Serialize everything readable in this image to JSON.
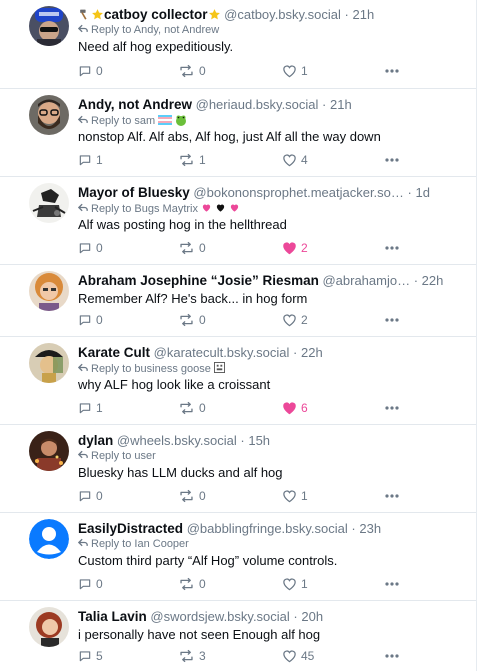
{
  "posts": [
    {
      "name": "catboy collector",
      "name_prefix_icons": [
        "hammer-icon",
        "star-icon"
      ],
      "name_suffix_icon": "star-icon",
      "handle": "@catboy.bsky.social",
      "time": "21h",
      "reply_to": "Reply to Andy, not Andrew",
      "text": "Need alf hog expeditiously.",
      "replies": "0",
      "reposts": "0",
      "likes": "1",
      "liked": false
    },
    {
      "name": "Andy, not Andrew",
      "handle": "@heriaud.bsky.social",
      "time": "21h",
      "reply_to": "Reply to sam",
      "reply_icons": [
        "flag-icon",
        "frog-icon"
      ],
      "text": "nonstop Alf. Alf abs, Alf hog, just Alf all the way down",
      "replies": "1",
      "reposts": "1",
      "likes": "4",
      "liked": false
    },
    {
      "name": "Mayor of Bluesky",
      "handle": "@bokononsprophet.meatjacker.so…",
      "time": "1d",
      "reply_to": "Reply to Bugs Maytrix",
      "reply_icons": [
        "pink-heart-icon",
        "black-heart-icon",
        "pink-heart-icon"
      ],
      "text": "Alf was posting hog in the hellthread",
      "replies": "0",
      "reposts": "0",
      "likes": "2",
      "liked": true
    },
    {
      "name": "Abraham Josephine “Josie” Riesman",
      "handle": "@abrahamjo…",
      "time": "22h",
      "reply_to": "",
      "text": "Remember Alf? He's back... in hog form",
      "replies": "0",
      "reposts": "0",
      "likes": "2",
      "liked": false
    },
    {
      "name": "Karate Cult",
      "handle": "@karatecult.bsky.social",
      "time": "22h",
      "reply_to": "Reply to business goose",
      "reply_icons": [
        "goose-icon"
      ],
      "text": "why ALF hog look like a croissant",
      "replies": "1",
      "reposts": "0",
      "likes": "6",
      "liked": true
    },
    {
      "name": "dylan",
      "handle": "@wheels.bsky.social",
      "time": "15h",
      "reply_to": "Reply to user",
      "text": "Bluesky has LLM ducks and alf hog",
      "replies": "0",
      "reposts": "0",
      "likes": "1",
      "liked": false
    },
    {
      "name": "EasilyDistracted",
      "handle": "@babblingfringe.bsky.social",
      "time": "23h",
      "reply_to": "Reply to Ian Cooper",
      "text": "Custom third party “Alf Hog” volume controls.",
      "replies": "0",
      "reposts": "0",
      "likes": "1",
      "liked": false
    },
    {
      "name": "Talia Lavin",
      "handle": "@swordsjew.bsky.social",
      "time": "20h",
      "reply_to": "",
      "text": "i personally have not seen Enough alf hog",
      "replies": "5",
      "reposts": "3",
      "likes": "45",
      "liked": false
    }
  ],
  "colors": {
    "liked": "#ec4899",
    "muted": "#6b7886",
    "divider": "#e3e8ed",
    "default_avatar": "#0a7aff"
  }
}
